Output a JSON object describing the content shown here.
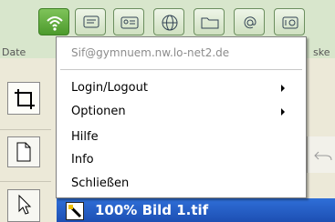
{
  "toolbar": {
    "labels": {
      "left": "Date",
      "right": "ske"
    },
    "buttons": [
      {
        "icon": "wireless-icon",
        "active": true
      },
      {
        "icon": "chat-icon"
      },
      {
        "icon": "contact-card-icon"
      },
      {
        "icon": "globe-icon"
      },
      {
        "icon": "folder-icon"
      },
      {
        "icon": "email-at-icon"
      },
      {
        "icon": "device-icon"
      }
    ]
  },
  "menu": {
    "header": "Sif@gymnuem.nw.lo-net2.de",
    "items": [
      {
        "label": "Login/Logout",
        "submenu": true
      },
      {
        "label": "Optionen",
        "submenu": true
      },
      {
        "label": "Hilfe",
        "submenu": false
      },
      {
        "label": "Info",
        "submenu": false
      },
      {
        "label": "Schließen",
        "submenu": false
      }
    ]
  },
  "document": {
    "title": "100% Bild 1.tif"
  },
  "colors": {
    "accent": "#4c9a2c",
    "titlebar": "#1d4fb3",
    "menu_header": "#8c8c8c"
  }
}
